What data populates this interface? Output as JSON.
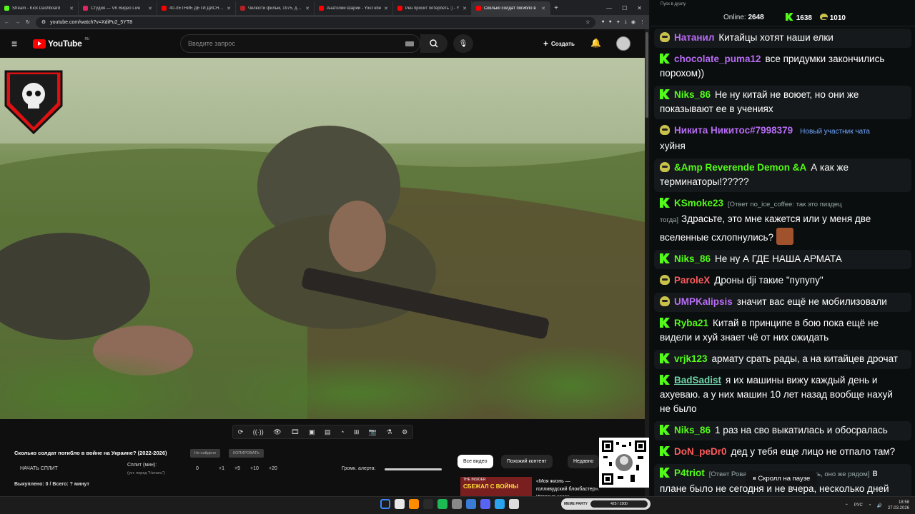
{
  "tabs": [
    {
      "label": "Stream - Kick Dashboard",
      "color": "#53fc18"
    },
    {
      "label": "Студия — VK Видео Live",
      "color": "#e0245e"
    },
    {
      "label": "40-ЛЕТНИЕ ДЕТИ ДИСНЕЕВ",
      "color": "#ff0000"
    },
    {
      "label": "Челюсти фильм, 1975, дата",
      "color": "#b22222"
    },
    {
      "label": "Анатолий Шарий - YouTube",
      "color": "#ff0000"
    },
    {
      "label": "Рен просит потерпеть :) - Y",
      "color": "#ff0000"
    },
    {
      "label": "Сколько солдат погибло в",
      "color": "#ff0000",
      "active": true
    }
  ],
  "url": "youtube.com/watch?v=XdiPu2_5YT8",
  "youtube": {
    "logo": "YouTube",
    "region": "RU",
    "search_placeholder": "Введите запрос",
    "create_label": "Создать"
  },
  "toolbar_icons": [
    "repeat-icon",
    "broadcast-icon",
    "eye-icon",
    "film-icon",
    "picture-icon",
    "subtitles-icon",
    "speed-icon",
    "frame-icon",
    "camera-icon",
    "flask-icon",
    "settings-icon"
  ],
  "video_info": {
    "title": "Сколько солдат погибло в войне на Украине? (2022-2026)",
    "badge_missing": "Не найдено",
    "badge_copy": "КОПИРОВАТЬ",
    "start_split": "НАЧАТЬ СПЛИТ",
    "split_label": "Сплит (мин):",
    "split_hint": "(уст. перед \"Начать\")",
    "split_value": "0",
    "split_buttons": [
      "+1",
      "+5",
      "+10",
      "+20"
    ],
    "bought": "Выкуплено: 0 / Всего: ? минут",
    "alert_volume": "Громк. алерта:"
  },
  "chips": [
    "Все видео",
    "Похожий контент",
    "Недавно"
  ],
  "recommended": {
    "thumb_text": "СБЕЖАЛ С ВОЙНЫ",
    "thumb_top": "THE INSIDER",
    "title": "«Моя жизнь — голливудский блокбастер». История казак..."
  },
  "kick_widget": {
    "label": "MEME PARTY",
    "progress": "425 / 1500"
  },
  "chat": {
    "window_title": "Пуск в дуэлу",
    "online_label": "Online:",
    "online": "2648",
    "kick_count": "1638",
    "vk_count": "1010",
    "pause_label": "⏸ Скролл на паузе",
    "messages": [
      {
        "icon": "pet",
        "user": "Натанил",
        "color": "#b76cf4",
        "text": "Китайцы хотят наши елки"
      },
      {
        "icon": "kick",
        "user": "chocolate_puma12",
        "color": "#b76cf4",
        "text": "все придумки закончились порохом))"
      },
      {
        "icon": "kick",
        "user": "Niks_86",
        "color": "#53fc18",
        "text": "Не ну китай не воюет, но они же показывают ее в учениях"
      },
      {
        "icon": "pet",
        "user": "Никита Никитос#7998379",
        "color": "#b76cf4",
        "badge": "Новый участник чата",
        "text": "хуйня"
      },
      {
        "icon": "pet",
        "user": "&Amp Reverende Demon &A",
        "color": "#53fc18",
        "text": "А как же терминаторы!?????"
      },
      {
        "icon": "kick",
        "user": "KSmoke23",
        "color": "#53fc18",
        "reply": "[Ответ no_ice_coffee: так это пиздец тогда]",
        "text": "Здрасьте, это мне кажется или у меня две вселенные схлопнулись?",
        "emote": true
      },
      {
        "icon": "kick",
        "user": "Niks_86",
        "color": "#53fc18",
        "text": "Не ну А ГДЕ НАША АРМАТА"
      },
      {
        "icon": "pet",
        "user": "ParoleX",
        "color": "#ff5c5c",
        "text": "Дроны dji такие \"пупупу\""
      },
      {
        "icon": "pet",
        "user": "UMPKalipsis",
        "color": "#b76cf4",
        "text": "значит вас ещё не мобилизовали"
      },
      {
        "icon": "kick",
        "user": "Ryba21",
        "color": "#53fc18",
        "text": "Китай в принципе в бою пока ещё не видели и хуй знает чё от них ожидать"
      },
      {
        "icon": "kick",
        "user": "vrjk123",
        "color": "#53fc18",
        "text": "армату срать рады, а на китайцев дрочат"
      },
      {
        "icon": "kick",
        "user": "BadSadist",
        "color": "#6fd3a8",
        "underline": true,
        "text": "я их машины вижу каждый день и ахуеваю. а у них машин 10 лет назад вообще нахуй не было"
      },
      {
        "icon": "kick",
        "user": "Niks_86",
        "color": "#53fc18",
        "text": "1 раз на сво выкатилась и обосралась"
      },
      {
        "icon": "kick",
        "user": "DoN_peDr0",
        "color": "#ff5c5c",
        "text": "дед у тебя еще лицо не отпало там?"
      },
      {
        "icon": "kick",
        "user": "P4triot",
        "color": "#53fc18",
        "reply": "[Ответ Ровар51: нему там волатать, оно же рядом]",
        "text": "в плане было не сегодня и не вчера, несколько дней назад"
      }
    ]
  },
  "taskbar": {
    "lang": "РУС",
    "time": "18:58",
    "date": "27.03.2026"
  }
}
